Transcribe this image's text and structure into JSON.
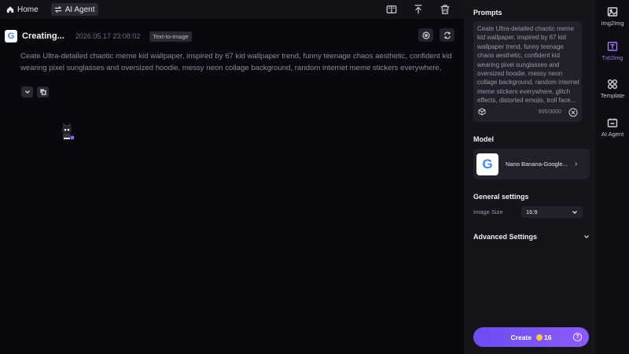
{
  "topbar": {
    "home_label": "Home",
    "agent_label": "AI Agent"
  },
  "task": {
    "title": "Creating...",
    "timestamp": "2026.05.17 23:08:02",
    "tag": "Text-to-image",
    "prompt": "Ceate Ultra-detailed chaotic meme kid wallpaper, inspired by 67 kid wallpaper trend, funny teenage chaos aesthetic, confident kid wearing pixel sunglasses and oversized hoodie, messy neon collage background, random internet meme stickers everywhere, glitch effects, distorted emojis, troll face, low-quality reaction memes, fake error windows, \"bro wha..."
  },
  "panel": {
    "prompts_title": "Prompts",
    "prompt_text": "Ceate Ultra-detailed chaotic meme kid wallpaper, inspired by 67 kid wallpaper trend, funny teenage chaos aesthetic, confident kid wearing pixel sunglasses and oversized hoodie, messy neon collage background, random internet meme stickers everywhere, glitch effects, distorted emojis, troll face...",
    "char_count": "995/3000",
    "model_title": "Model",
    "model_name": "Nano Banana-Google...",
    "general_title": "General settings",
    "image_size_label": "Image Size",
    "image_size_value": "16:9",
    "advanced_title": "Advanced Settings",
    "create_label": "Create",
    "credits": "16"
  },
  "sidenav": {
    "items": [
      {
        "label": "Img2Img",
        "icon": "image-icon"
      },
      {
        "label": "Txt2Img",
        "icon": "text-image-icon"
      },
      {
        "label": "Template",
        "icon": "template-icon"
      },
      {
        "label": "AI Agent",
        "icon": "agent-icon"
      }
    ]
  },
  "colors": {
    "accent": "#8a5cf6",
    "background": "#0a080f",
    "panel": "#16141b"
  }
}
